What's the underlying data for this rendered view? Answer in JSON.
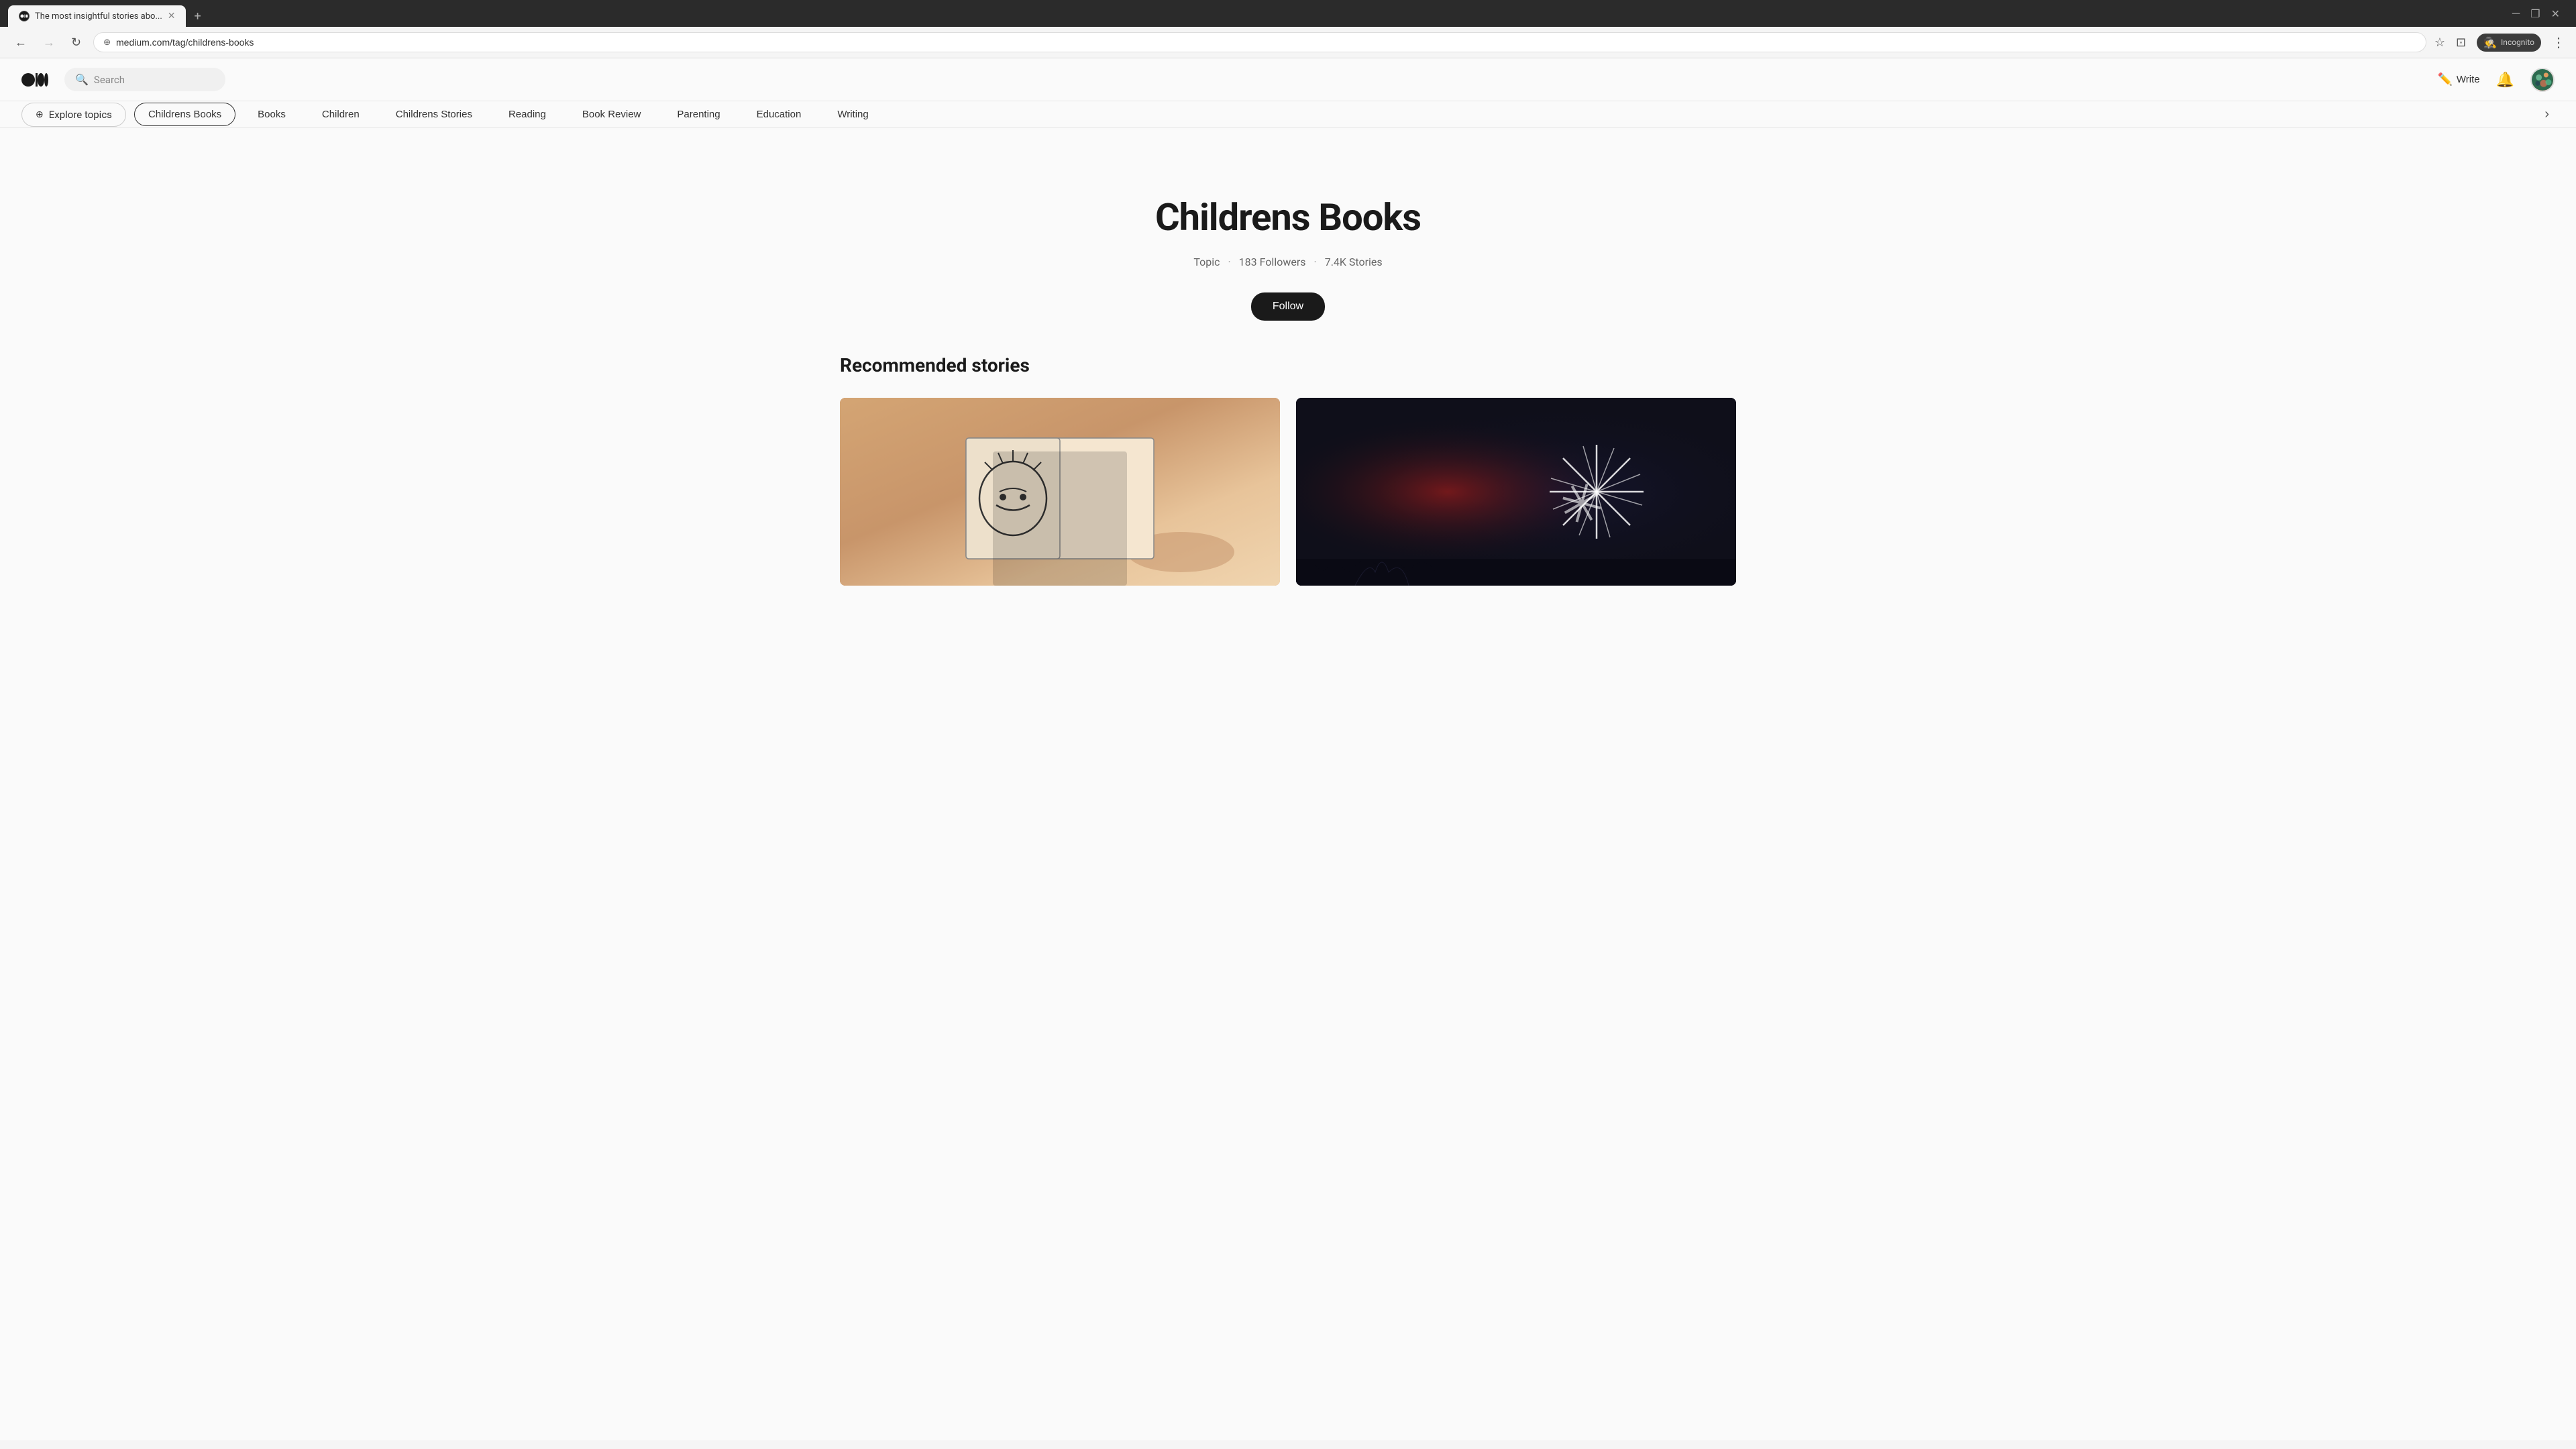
{
  "browser": {
    "tabs": [
      {
        "id": "tab-1",
        "title": "The most insightful stories abo...",
        "active": true,
        "favicon": "M"
      }
    ],
    "address": "medium.com/tag/childrens-books",
    "nav": {
      "back_disabled": false,
      "forward_disabled": true
    },
    "toolbar": {
      "incognito_label": "Incognito",
      "more_label": "⋮"
    }
  },
  "header": {
    "logo_alt": "Medium",
    "search_placeholder": "Search",
    "write_label": "Write",
    "notification_label": "Notifications",
    "avatar_alt": "User avatar"
  },
  "tags_bar": {
    "explore_label": "Explore topics",
    "tags": [
      {
        "id": "childrens-books",
        "label": "Childrens Books",
        "active": true
      },
      {
        "id": "books",
        "label": "Books",
        "active": false
      },
      {
        "id": "children",
        "label": "Children",
        "active": false
      },
      {
        "id": "childrens-stories",
        "label": "Childrens Stories",
        "active": false
      },
      {
        "id": "reading",
        "label": "Reading",
        "active": false
      },
      {
        "id": "book-review",
        "label": "Book Review",
        "active": false
      },
      {
        "id": "parenting",
        "label": "Parenting",
        "active": false
      },
      {
        "id": "education",
        "label": "Education",
        "active": false
      },
      {
        "id": "writing",
        "label": "Writing",
        "active": false
      }
    ],
    "scroll_right_label": "›"
  },
  "topic": {
    "title": "Childrens Books",
    "type_label": "Topic",
    "followers_count": "183 Followers",
    "stories_count": "7.4K Stories",
    "follow_label": "Follow"
  },
  "recommended": {
    "section_title": "Recommended stories",
    "stories": [
      {
        "id": "story-1",
        "image_type": "left",
        "image_alt": "Book drawing illustration"
      },
      {
        "id": "story-2",
        "image_type": "right",
        "image_alt": "Dark space with starburst"
      }
    ]
  },
  "colors": {
    "active_tab_bg": "#f5f5f5",
    "inactive_tab_bg": "#3c3c3c",
    "follow_btn_bg": "#1a1a1a",
    "follow_btn_text": "#ffffff",
    "active_tag_border": "#333333"
  }
}
